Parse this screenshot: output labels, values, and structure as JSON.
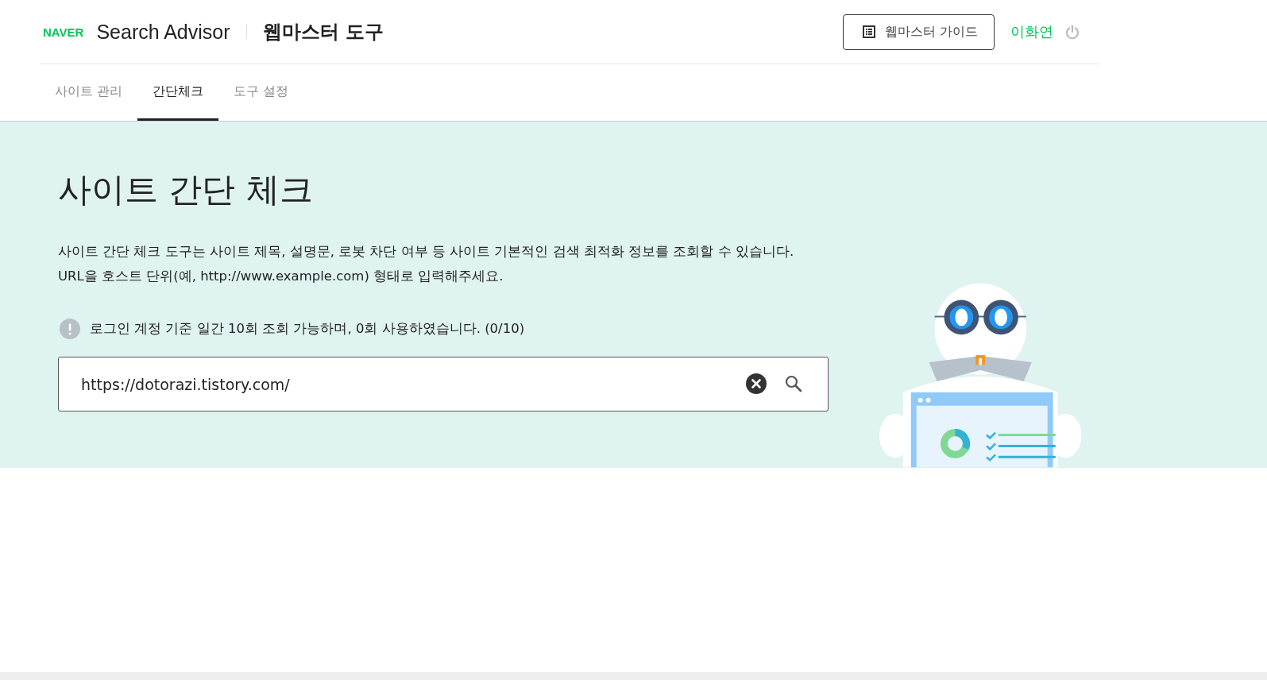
{
  "header": {
    "logo": "NAVER",
    "product": "Search Advisor",
    "section": "웹마스터 도구",
    "guide_button": "웹마스터 가이드",
    "user": "이화연"
  },
  "tabs": [
    {
      "label": "사이트 관리",
      "selected": false
    },
    {
      "label": "간단체크",
      "selected": true
    },
    {
      "label": "도구 설정",
      "selected": false
    }
  ],
  "hero": {
    "title": "사이트 간단 체크",
    "description": [
      "사이트 간단 체크 도구는 사이트 제목, 설명문, 로봇 차단 여부 등 사이트 기본적인 검색 최적화 정보를 조회할 수 있습니다.",
      "URL을 호스트 단위(예, http://www.example.com) 형태로 입력해주세요."
    ],
    "notice": "로그인 계정 기준 일간 10회 조회 가능하며, 0회 사용하였습니다. (0/10)",
    "url_field": {
      "value": "https://dotorazi.tistory.com/"
    }
  }
}
